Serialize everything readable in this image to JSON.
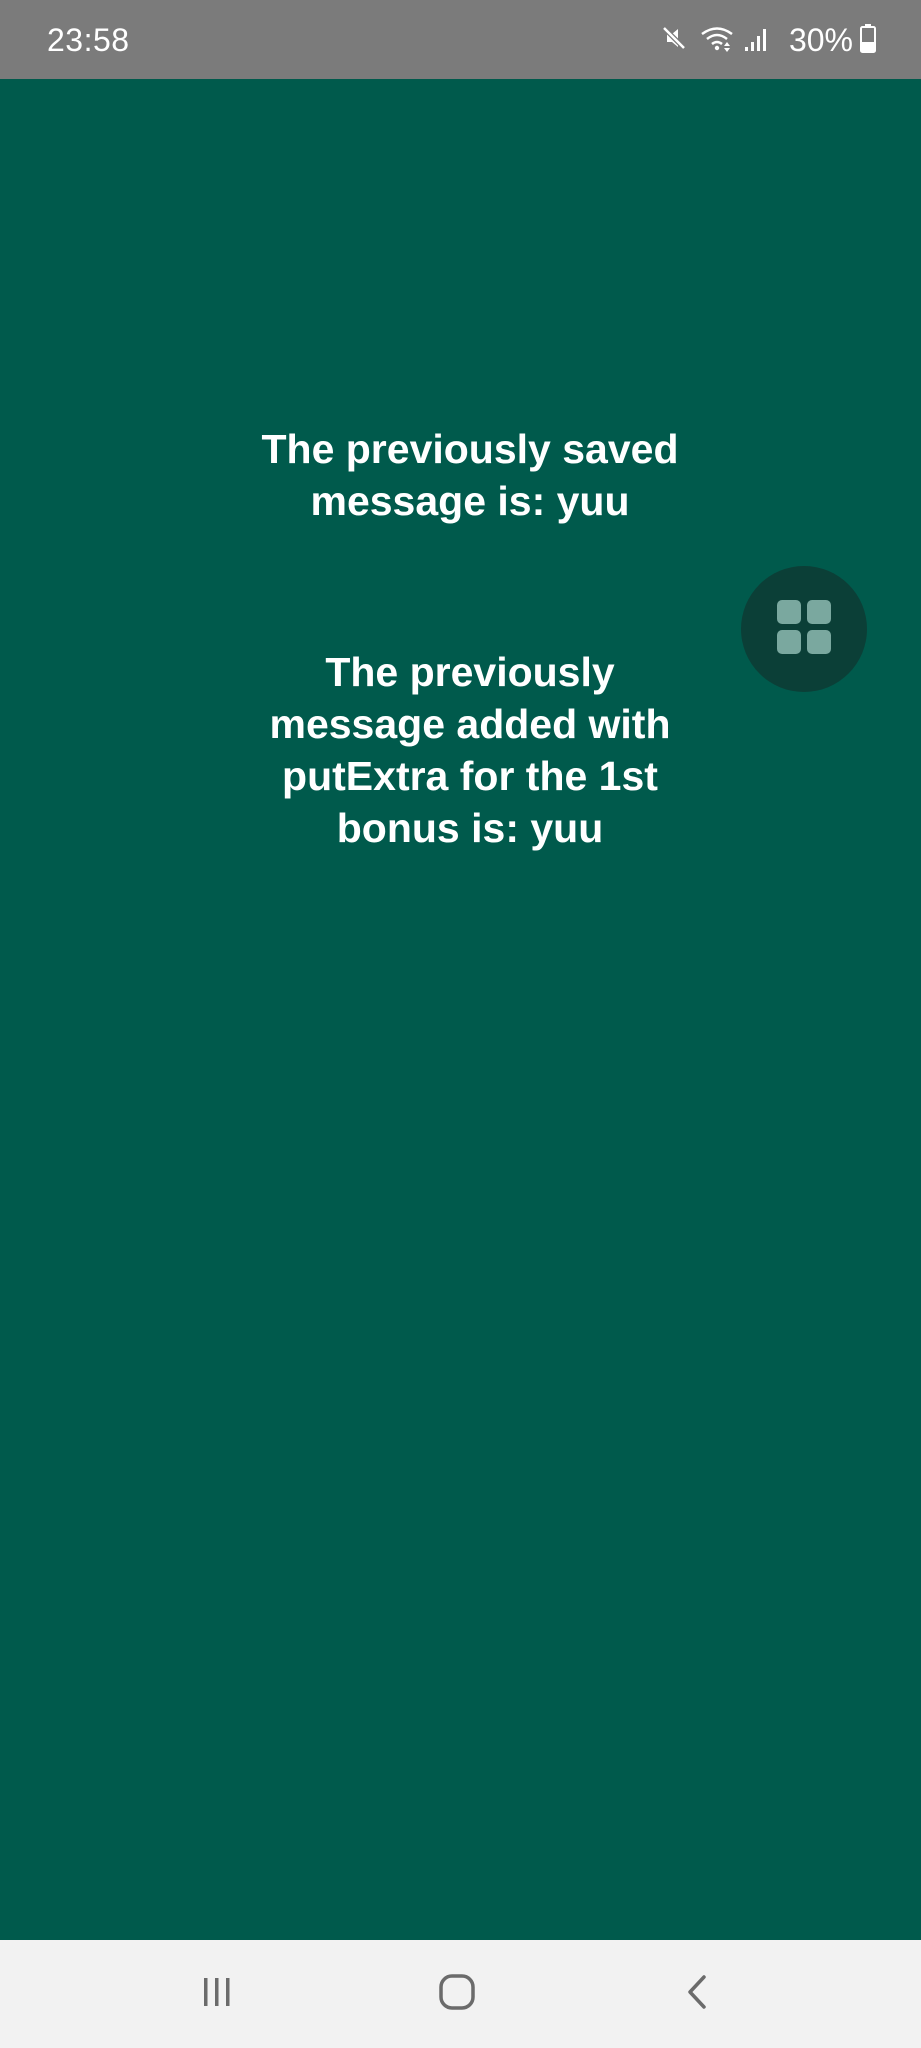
{
  "status_bar": {
    "time": "23:58",
    "battery": "30%",
    "icons": [
      "mute-icon",
      "wifi-icon",
      "signal-icon",
      "battery-icon"
    ]
  },
  "main": {
    "saved_message": "The previously saved message is: yuu",
    "extra_message": "The previously message added with putExtra for the 1st bonus is: yuu"
  },
  "floating_button": {
    "icon": "grid-icon"
  },
  "nav_bar": {
    "icons": [
      "recent-apps-icon",
      "home-icon",
      "back-icon"
    ]
  },
  "colors": {
    "background": "#005a4c",
    "status_bar": "#7b7b7b",
    "floating_button": "#0b3f37",
    "nav_bar": "#f2f2f2",
    "text": "#ffffff"
  }
}
